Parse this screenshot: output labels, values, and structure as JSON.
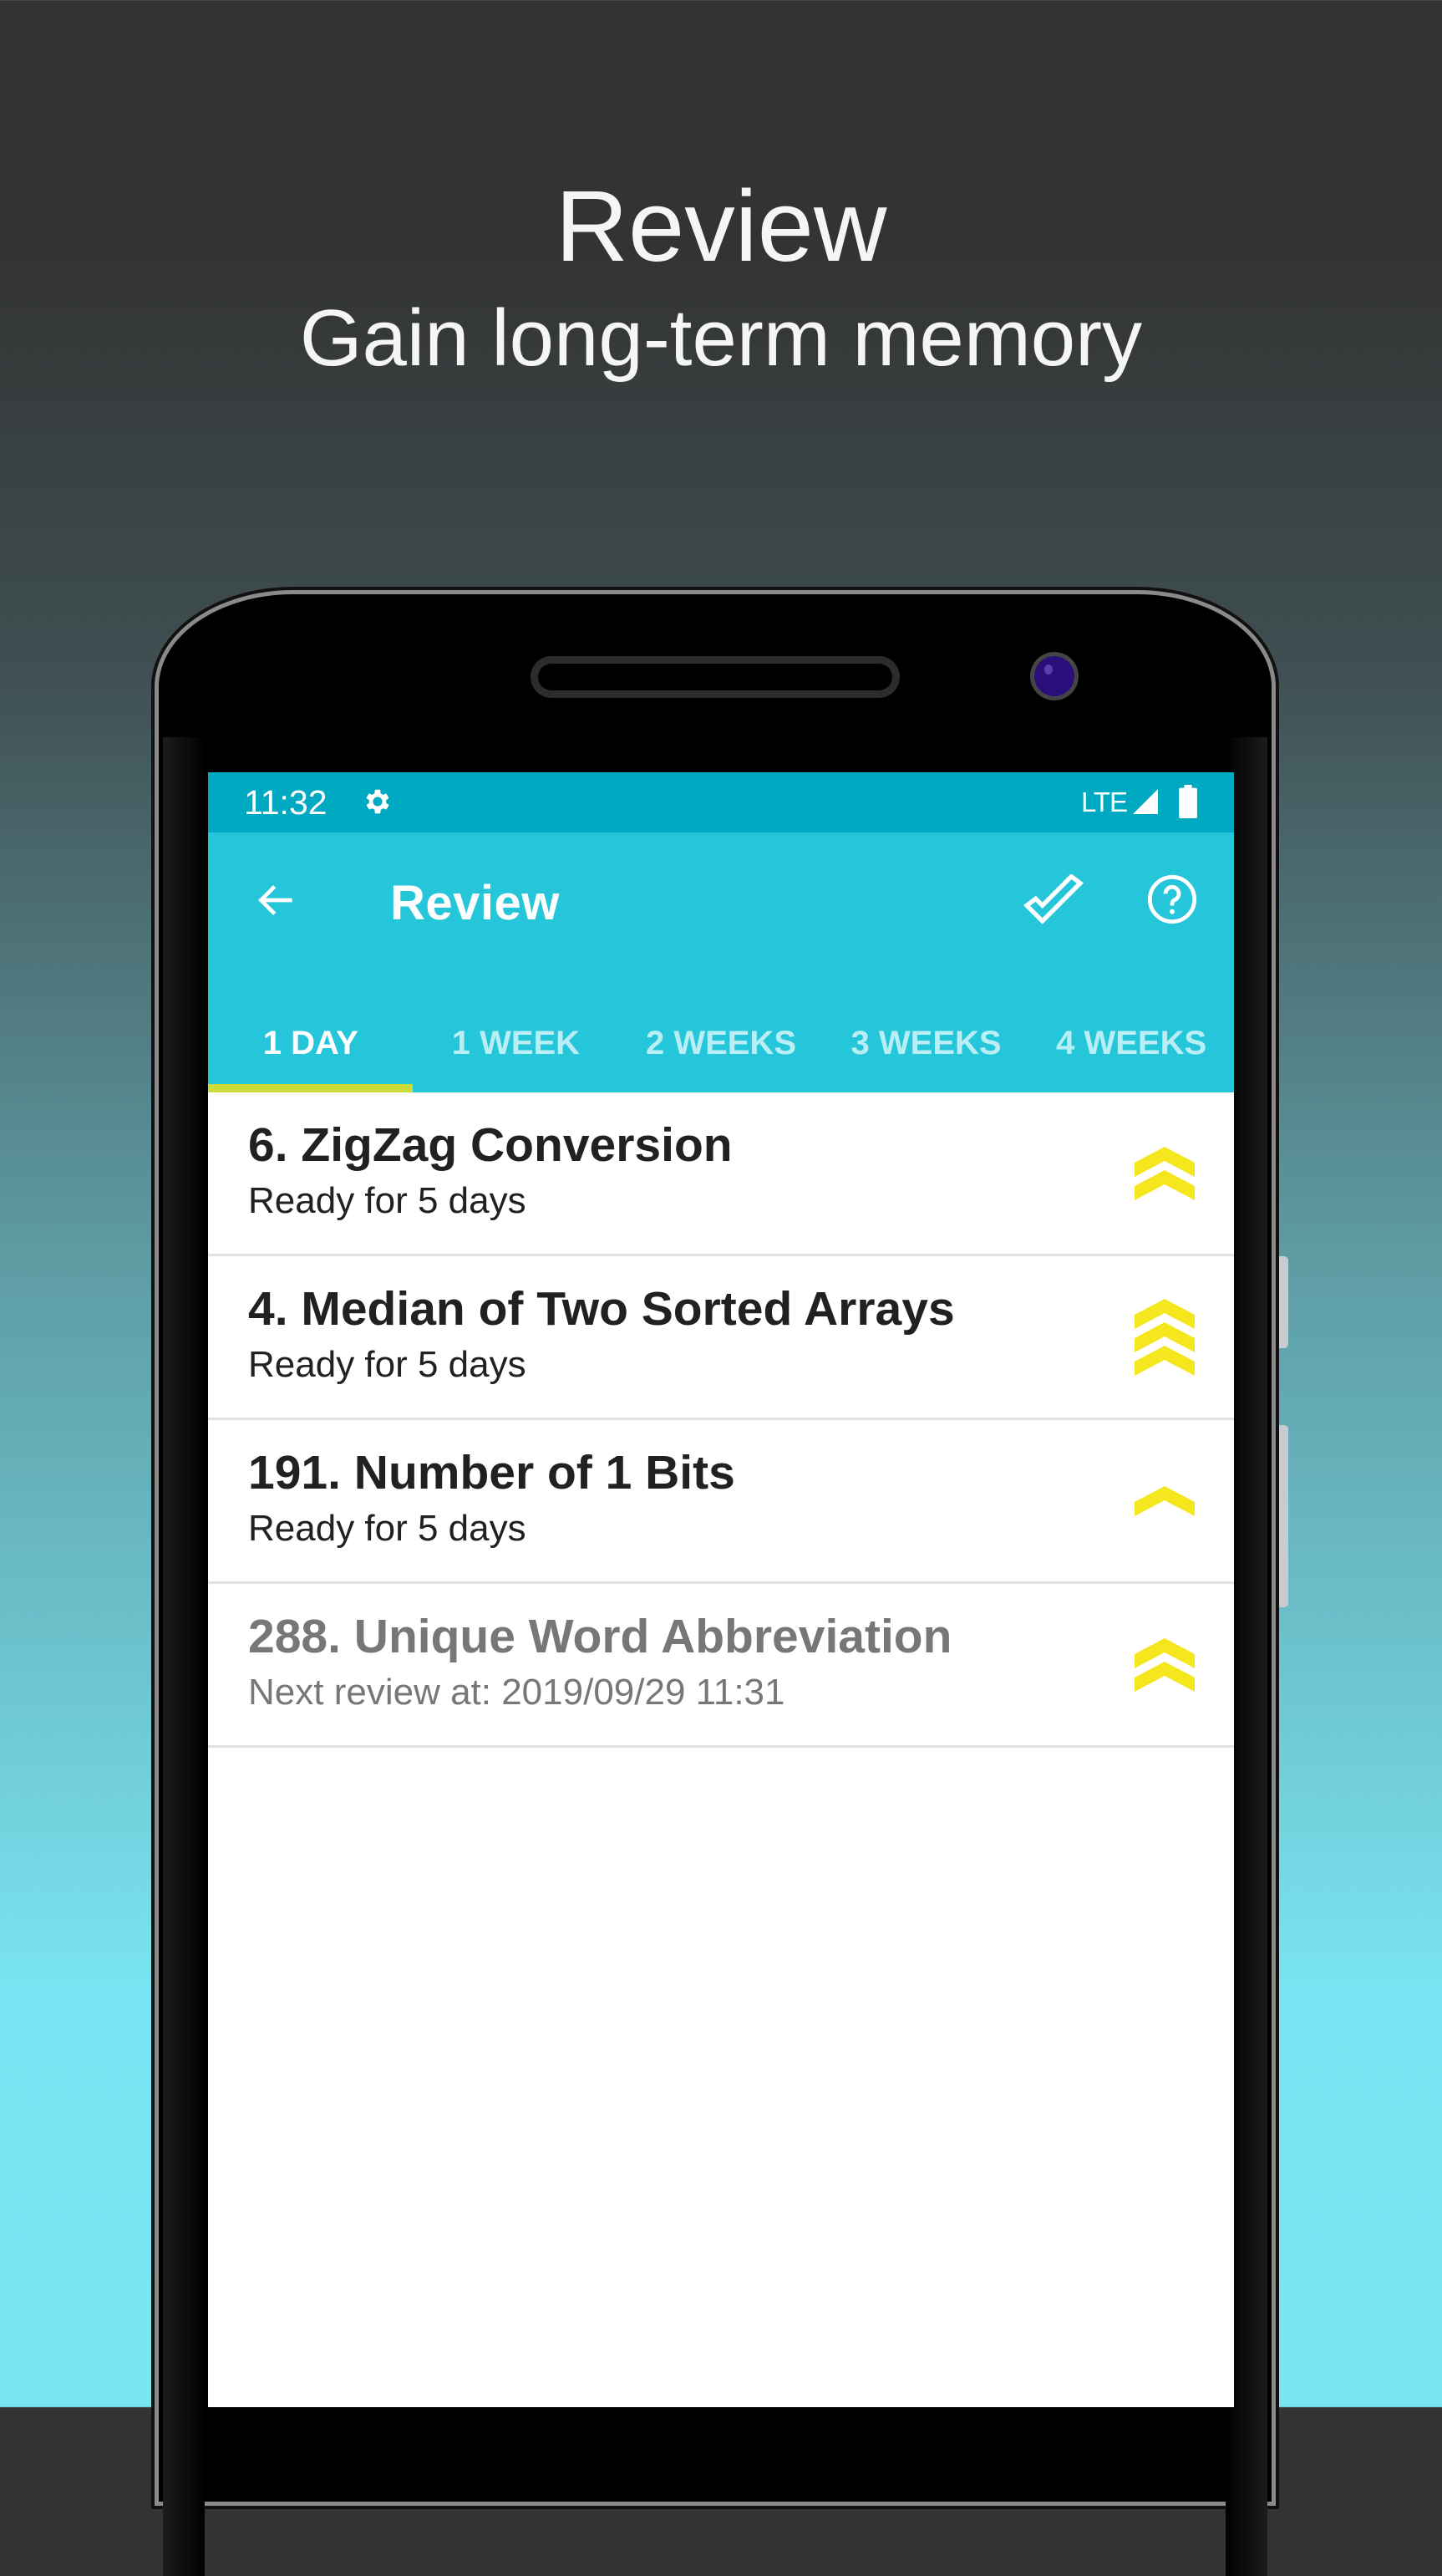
{
  "promo": {
    "title": "Review",
    "subtitle": "Gain long-term memory"
  },
  "status_bar": {
    "time": "11:32",
    "network": "LTE",
    "icons": [
      "settings-gear-icon",
      "signal-icon",
      "battery-icon"
    ]
  },
  "toolbar": {
    "back_icon": "arrow-left-icon",
    "title": "Review",
    "actions": [
      {
        "name": "mark-done",
        "icon": "check-icon"
      },
      {
        "name": "help",
        "icon": "help-circle-icon"
      }
    ]
  },
  "tabs": [
    {
      "label": "1 DAY",
      "active": true
    },
    {
      "label": "1 WEEK",
      "active": false
    },
    {
      "label": "2 WEEKS",
      "active": false
    },
    {
      "label": "3 WEEKS",
      "active": false
    },
    {
      "label": "4 WEEKS",
      "active": false
    }
  ],
  "items": [
    {
      "title": "6. ZigZag Conversion",
      "subtitle": "Ready for 5 days",
      "level": 2,
      "disabled": false
    },
    {
      "title": "4. Median of Two Sorted Arrays",
      "subtitle": "Ready for 5 days",
      "level": 3,
      "disabled": false
    },
    {
      "title": "191. Number of 1 Bits",
      "subtitle": "Ready for 5 days",
      "level": 1,
      "disabled": false
    },
    {
      "title": "288. Unique Word Abbreviation",
      "subtitle": "Next review at: 2019/09/29 11:31",
      "level": 2,
      "disabled": true
    }
  ],
  "colors": {
    "status_bar": "#00a9c2",
    "primary": "#26c6da",
    "tab_indicator": "#cddc39",
    "level_chevron": "#f5e61e",
    "text_primary": "#212121",
    "text_disabled": "#777777"
  }
}
